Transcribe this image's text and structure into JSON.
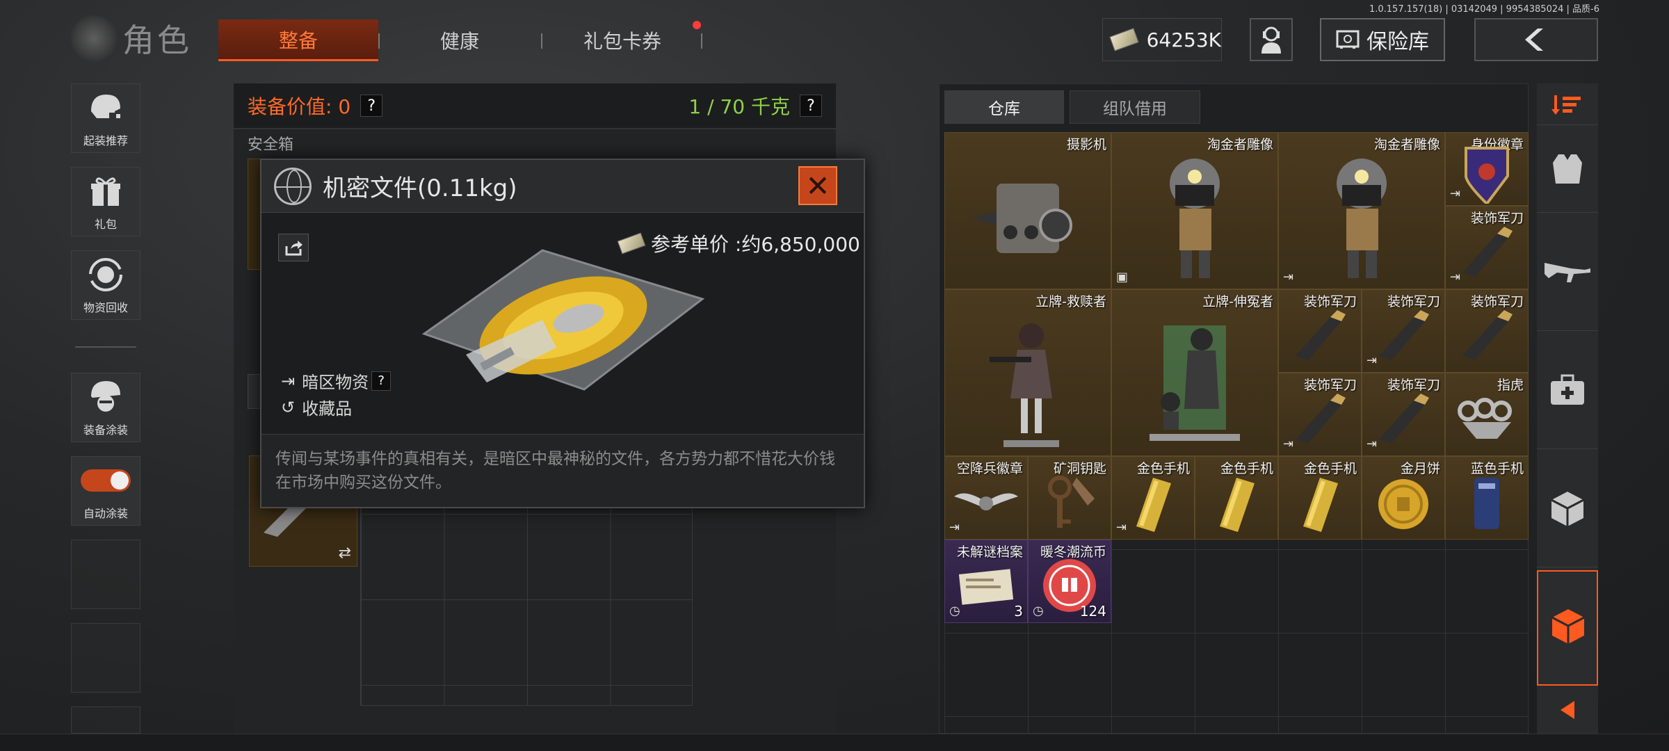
{
  "version": "1.0.157.157(18) | 03142049 | 9954385024 | 品质-6",
  "header": {
    "title": "角色",
    "tabs": [
      {
        "label": "整备",
        "active": true
      },
      {
        "label": "健康",
        "active": false
      },
      {
        "label": "礼包卡券",
        "active": false
      }
    ],
    "currency": "64253K",
    "vault_label": "保险库"
  },
  "sidebar": {
    "items": [
      {
        "label": "起装推荐"
      },
      {
        "label": "礼包"
      },
      {
        "label": "物资回收"
      },
      {
        "label": "装备涂装"
      },
      {
        "label": "自动涂装"
      }
    ]
  },
  "equipment": {
    "value_label": "装备价值: 0",
    "weight_label": "1 / 70 千克",
    "safe_box_label": "安全箱"
  },
  "inventory": {
    "tabs": [
      {
        "label": "仓库",
        "active": true
      },
      {
        "label": "组队借用",
        "active": false
      }
    ],
    "items": [
      {
        "name": "摄影机"
      },
      {
        "name": "淘金者雕像"
      },
      {
        "name": "淘金者雕像"
      },
      {
        "name": "身份徽章"
      },
      {
        "name": "装饰军刀"
      },
      {
        "name": "立牌-救赎者"
      },
      {
        "name": "立牌-伸冤者"
      },
      {
        "name": "装饰军刀"
      },
      {
        "name": "装饰军刀"
      },
      {
        "name": "装饰军刀"
      },
      {
        "name": "装饰军刀"
      },
      {
        "name": "装饰军刀"
      },
      {
        "name": "指虎"
      },
      {
        "name": "空降兵徽章"
      },
      {
        "name": "矿洞钥匙"
      },
      {
        "name": "金色手机"
      },
      {
        "name": "金色手机"
      },
      {
        "name": "金色手机"
      },
      {
        "name": "金月饼"
      },
      {
        "name": "蓝色手机"
      },
      {
        "name": "未解谜档案",
        "count": "3"
      },
      {
        "name": "暖冬潮流币",
        "count": "124"
      }
    ]
  },
  "modal": {
    "title": "机密文件(0.11kg)",
    "price": "参考单价 :约6,850,000",
    "tag_dark_zone": "暗区物资",
    "tag_collectible": "收藏品",
    "description": "传闻与某场事件的真相有关，是暗区中最神秘的文件，各方势力都不惜花大价钱在市场中购买这份文件。"
  },
  "colors": {
    "accent": "#ff5a1f",
    "weight_green": "#8fd14a",
    "value_orange": "#ff6a2a",
    "item_gold_bg": "#4a3a1f",
    "item_purple_bg": "#3a2a52"
  }
}
